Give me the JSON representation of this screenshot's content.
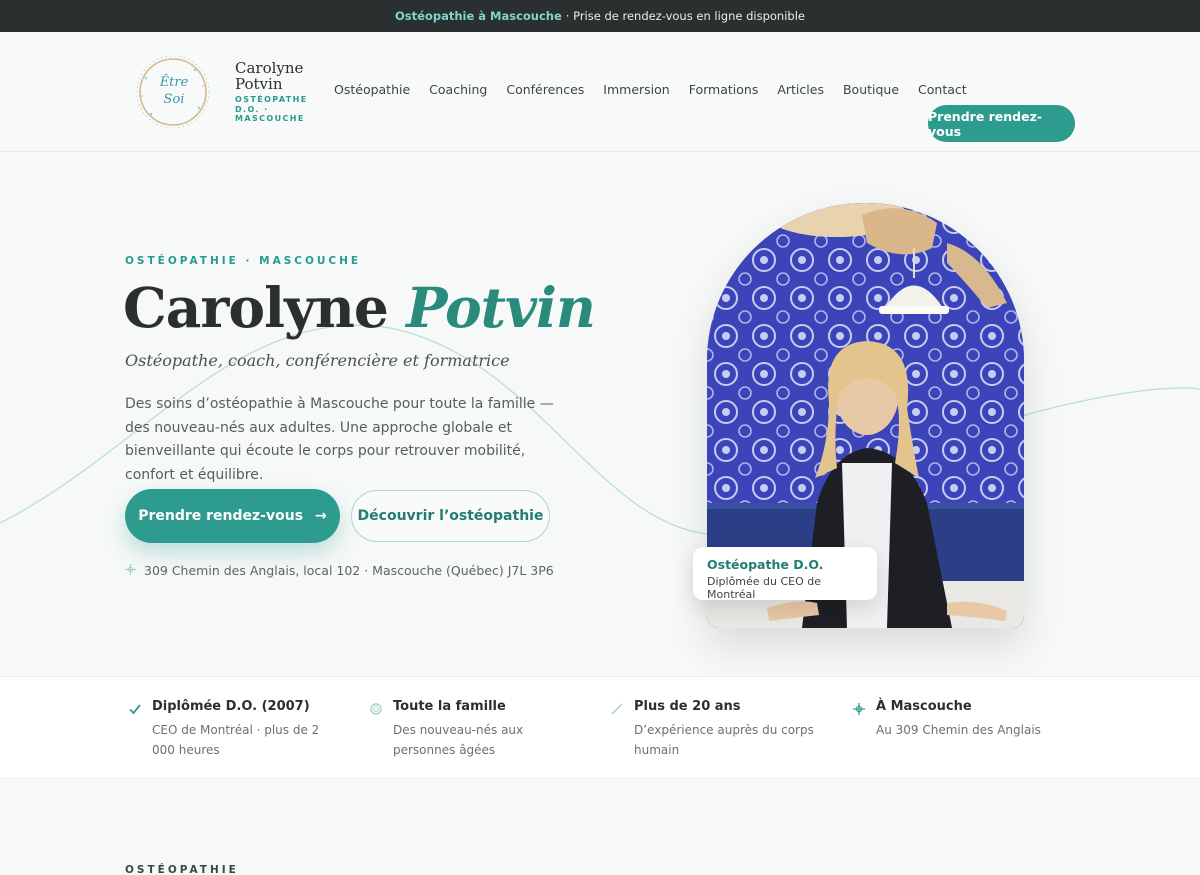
{
  "announcement": {
    "highlight": "Ostéopathie à Mascouche",
    "rest": "· Prise de rendez-vous en ligne disponible"
  },
  "logo": {
    "script": "Être Soi",
    "name_line1": "Carolyne",
    "name_line2": "Potvin",
    "sub_line1": "OSTÉOPATHE",
    "sub_line2": "D.O. ·",
    "sub_line3": "MASCOUCHE"
  },
  "nav": {
    "items": [
      "Ostéopathie",
      "Coaching",
      "Conférences",
      "Immersion",
      "Formations",
      "Articles",
      "Boutique",
      "Contact"
    ],
    "cta": "Prendre rendez-vous"
  },
  "hero": {
    "eyebrow": "OSTÉOPATHIE · MASCOUCHE",
    "title_first": "Carolyne",
    "title_accent": "Potvin",
    "subtitle": "Ostéopathe, coach, conférencière et formatrice",
    "intro": "Des soins d’ostéopathie à Mascouche pour toute la famille — des nouveau-nés aux adultes. Une approche globale et bienveillante qui écoute le corps pour retrouver mobilité, confort et équilibre.",
    "primary_button": "Prendre rendez-vous",
    "primary_arrow": "→",
    "secondary_button": "Découvrir l’ostéopathie",
    "address": "309 Chemin des Anglais, local 102 · Mascouche (Québec) J7L 3P6"
  },
  "badge": {
    "title": "Ostéopathe D.O.",
    "subtitle": "Diplômée du CEO de Montréal"
  },
  "features": [
    {
      "icon": "check-icon",
      "title": "Diplômée D.O. (2007)",
      "desc": "CEO de Montréal · plus de 2 000 heures"
    },
    {
      "icon": "circle-icon",
      "title": "Toute la famille",
      "desc": "Des nouveau-nés aux personnes âgées"
    },
    {
      "icon": "arrow-up-right-icon",
      "title": "Plus de 20 ans",
      "desc": "D’expérience auprès du corps humain"
    },
    {
      "icon": "location-icon",
      "title": "À Mascouche",
      "desc": "Au 309 Chemin des Anglais"
    }
  ],
  "next_section": {
    "eyebrow": "OSTÉOPATHIE"
  },
  "colors": {
    "accent": "#2d9b8d",
    "dark_bar": "#2a302f",
    "background": "#f6f9f8"
  }
}
